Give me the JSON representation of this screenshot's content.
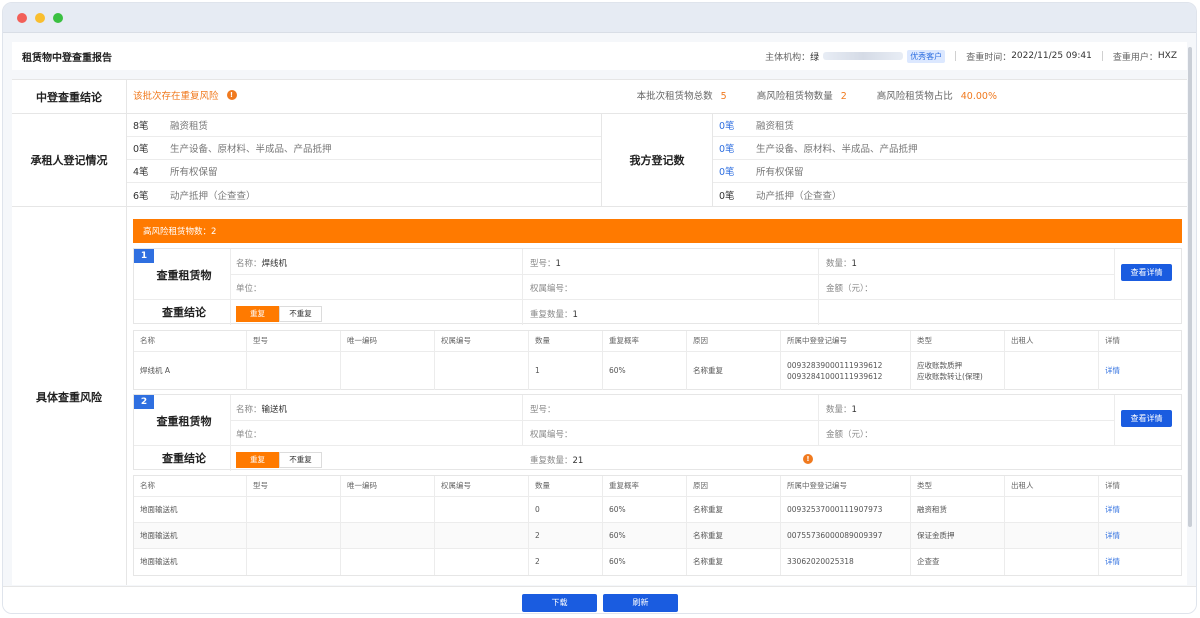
{
  "header": {
    "title": "租赁物中登查重报告",
    "org_label": "主体机构：",
    "org_prefix": "绿",
    "org_tag": "优秀客户",
    "time_label": "查重时间：",
    "time_value": "2022/11/25 09:41",
    "user_label": "查重用户：",
    "user_value": "HXZ"
  },
  "conclusion": {
    "label": "中登查重结论",
    "text": "该批次存在重复风险",
    "total_label": "本批次租赁物总数",
    "total_value": "5",
    "high_label": "高风险租赁物数量",
    "high_value": "2",
    "ratio_label": "高风险租赁物占比",
    "ratio_value": "40.00%"
  },
  "lessee": {
    "label": "承租人登记情况",
    "items": [
      {
        "count": "8笔",
        "desc": "融资租赁"
      },
      {
        "count": "0笔",
        "desc": "生产设备、原材料、半成品、产品抵押"
      },
      {
        "count": "4笔",
        "desc": "所有权保留"
      },
      {
        "count": "6笔",
        "desc": "动产抵押（企查查）"
      }
    ],
    "our_label": "我方登记数",
    "our_items": [
      {
        "count": "0笔",
        "desc": "融资租赁"
      },
      {
        "count": "0笔",
        "desc": "生产设备、原材料、半成品、产品抵押"
      },
      {
        "count": "0笔",
        "desc": "所有权保留"
      },
      {
        "count": "0笔",
        "desc": "动产抵押（企查查）"
      }
    ]
  },
  "risk": {
    "label": "具体查重风险",
    "bar_text": "高风险租赁物数：2",
    "check_item_label": "查重租赁物",
    "check_result_label": "查重结论",
    "name_label": "名称：",
    "model_label": "型号：",
    "qty_label": "数量：",
    "unit_label": "单位：",
    "cert_label": "权属编号：",
    "amount_label": "金额（元）：",
    "dup_qty_label": "重复数量：",
    "btn_detail": "查看详情",
    "toggle_dup": "重复",
    "toggle_nodup": "不重复",
    "columns": [
      "名称",
      "型号",
      "唯一编码",
      "权属编号",
      "数量",
      "重复概率",
      "原因",
      "所属中登登记编号",
      "类型",
      "出租人",
      "详情"
    ],
    "items": [
      {
        "index": "1",
        "name": "焊线机",
        "model": "1",
        "qty": "1",
        "dup_qty": "1",
        "rows": [
          {
            "name": "焊线机 A",
            "model": "",
            "code": "",
            "cert": "",
            "qty": "1",
            "prob": "60%",
            "reason": "名称重复",
            "reg1": "00932839000111939612",
            "reg2": "00932841000111939612",
            "type1": "应收账款质押",
            "type2": "应收账款转让(保理)",
            "lessor": "",
            "detail": "详情"
          }
        ]
      },
      {
        "index": "2",
        "name": "输送机",
        "model": "",
        "qty": "1",
        "dup_qty": "21",
        "rows": [
          {
            "name": "地面输送机",
            "model": "",
            "code": "",
            "cert": "",
            "qty": "0",
            "prob": "60%",
            "reason": "名称重复",
            "reg1": "00932537000111907973",
            "type1": "融资租赁",
            "lessor": "",
            "detail": "详情"
          },
          {
            "name": "地面输送机",
            "model": "",
            "code": "",
            "cert": "",
            "qty": "2",
            "prob": "60%",
            "reason": "名称重复",
            "reg1": "00755736000089009397",
            "type1": "保证金质押",
            "lessor": "",
            "detail": "详情"
          },
          {
            "name": "地面输送机",
            "model": "",
            "code": "",
            "cert": "",
            "qty": "2",
            "prob": "60%",
            "reason": "名称重复",
            "reg1": "33062020025318",
            "type1": "企查查",
            "lessor": "",
            "detail": "详情"
          }
        ]
      }
    ]
  },
  "footer": {
    "download": "下载",
    "refresh": "刷新"
  }
}
